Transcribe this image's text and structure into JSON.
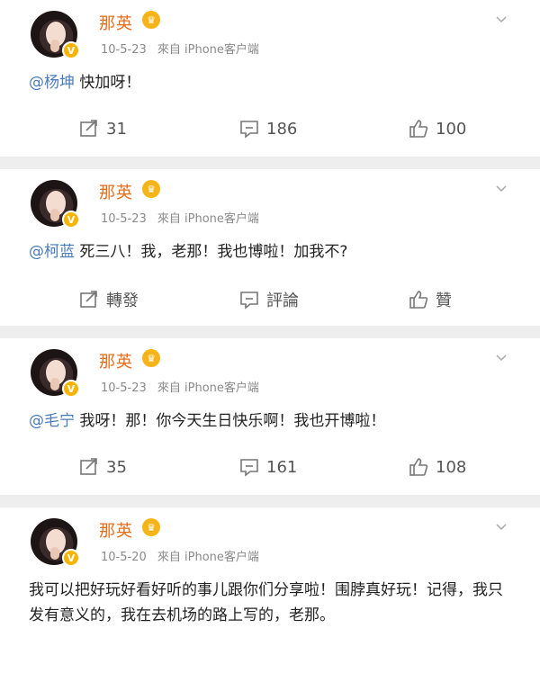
{
  "posts": [
    {
      "user": "那英",
      "date": "10-5-23",
      "source": "來自 iPhone客户端",
      "mention": "@杨坤",
      "text": " 快加呀！",
      "actions": {
        "repost": "31",
        "comment": "186",
        "like": "100"
      }
    },
    {
      "user": "那英",
      "date": "10-5-23",
      "source": "來自 iPhone客户端",
      "mention": "@柯蓝",
      "text": " 死三八！我，老那！我也博啦！加我不?",
      "actions": {
        "repost": "轉發",
        "comment": "評論",
        "like": "贊"
      }
    },
    {
      "user": "那英",
      "date": "10-5-23",
      "source": "來自 iPhone客户端",
      "mention": "@毛宁",
      "text": " 我呀！那！你今天生日快乐啊！我也开博啦！",
      "actions": {
        "repost": "35",
        "comment": "161",
        "like": "108"
      }
    },
    {
      "user": "那英",
      "date": "10-5-20",
      "source": "來自 iPhone客户端",
      "mention": "",
      "text": "我可以把好玩好看好听的事儿跟你们分享啦！围脖真好玩！记得，我只发有意义的，我在去机场的路上写的，老那。"
    }
  ],
  "colors": {
    "name": "#e86b17",
    "mention": "#4a7bbb",
    "badge": "#f7b400",
    "separator": "#eeeeee"
  },
  "icons": {
    "repost": "repost-icon",
    "comment": "comment-icon",
    "like": "thumbs-up-icon",
    "menu": "chevron-down-icon",
    "verified": "verified-v-icon",
    "crown": "vip-crown-icon"
  }
}
